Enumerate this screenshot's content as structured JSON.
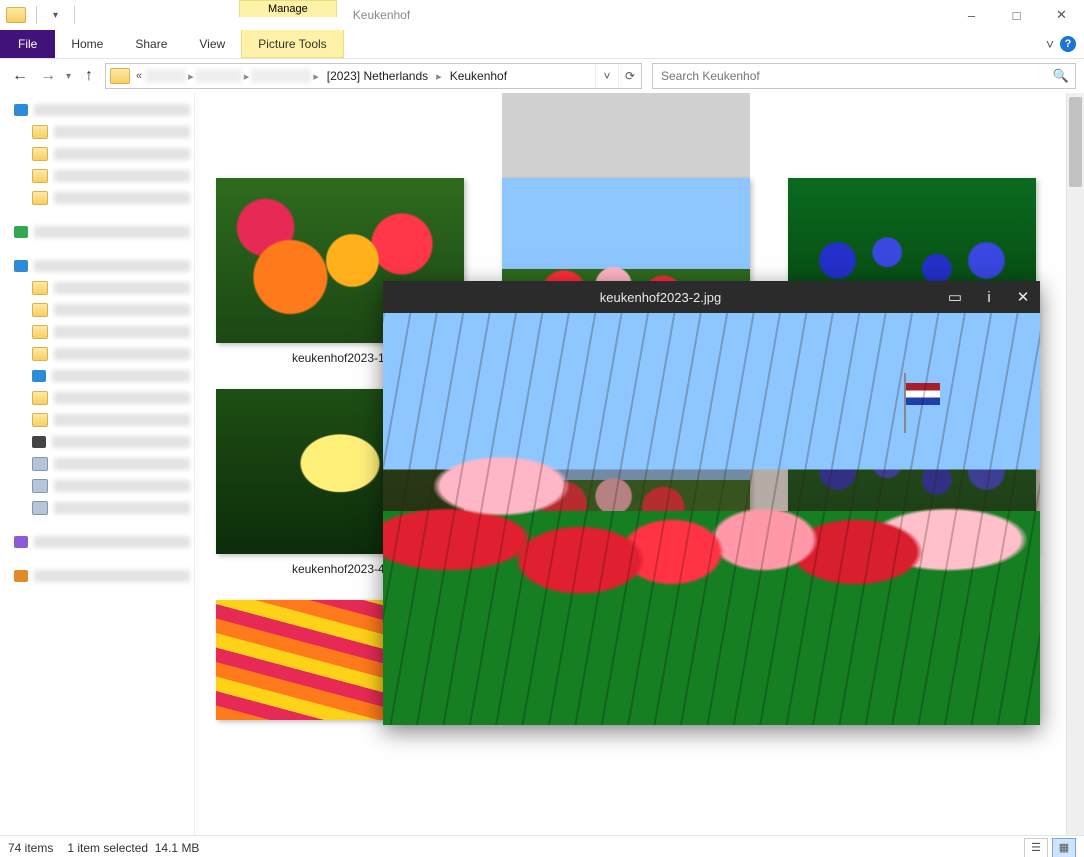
{
  "window": {
    "title": "Keukenhof",
    "contextTabLabel": "Manage",
    "contextToolsLabel": "Picture Tools"
  },
  "ribbonTabs": {
    "file": "File",
    "home": "Home",
    "share": "Share",
    "view": "View"
  },
  "breadcrumb": {
    "seg1": "[2023] Netherlands",
    "seg2": "Keukenhof"
  },
  "search": {
    "placeholder": "Search Keukenhof"
  },
  "thumbnails": {
    "t1": "keukenhof2023-1.",
    "t4": "keukenhof2023-4."
  },
  "preview": {
    "filename": "keukenhof2023-2.jpg"
  },
  "status": {
    "items": "74 items",
    "selection": "1 item selected",
    "size": "14.1 MB"
  }
}
